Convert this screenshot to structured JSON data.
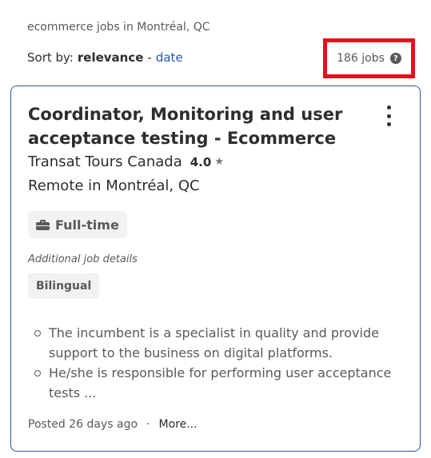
{
  "breadcrumb": "ecommerce jobs in Montréal, QC",
  "sort": {
    "label": "Sort by:",
    "current": "relevance",
    "separator": "-",
    "alternative": "date"
  },
  "job_count": "186 jobs",
  "help_icon": "?",
  "job": {
    "title": "Coordinator, Monitoring and user acceptance testing - Ecommerce",
    "company": "Transat Tours Canada",
    "rating": "4.0",
    "rating_icon": "★",
    "location": "Remote in Montréal, QC",
    "job_type": "Full-time",
    "details_label": "Additional job details",
    "details": [
      "Bilingual"
    ],
    "snippet": [
      "The incumbent is a specialist in quality and provide support to the business on digital platforms.",
      "He/she is responsible for performing user acceptance tests ..."
    ],
    "posted": "Posted 26 days ago",
    "footer_dot": "·",
    "more_label": "More..."
  },
  "colors": {
    "card_border": "#2557a7",
    "link": "#2557a7",
    "highlight_box": "#e0131e"
  }
}
